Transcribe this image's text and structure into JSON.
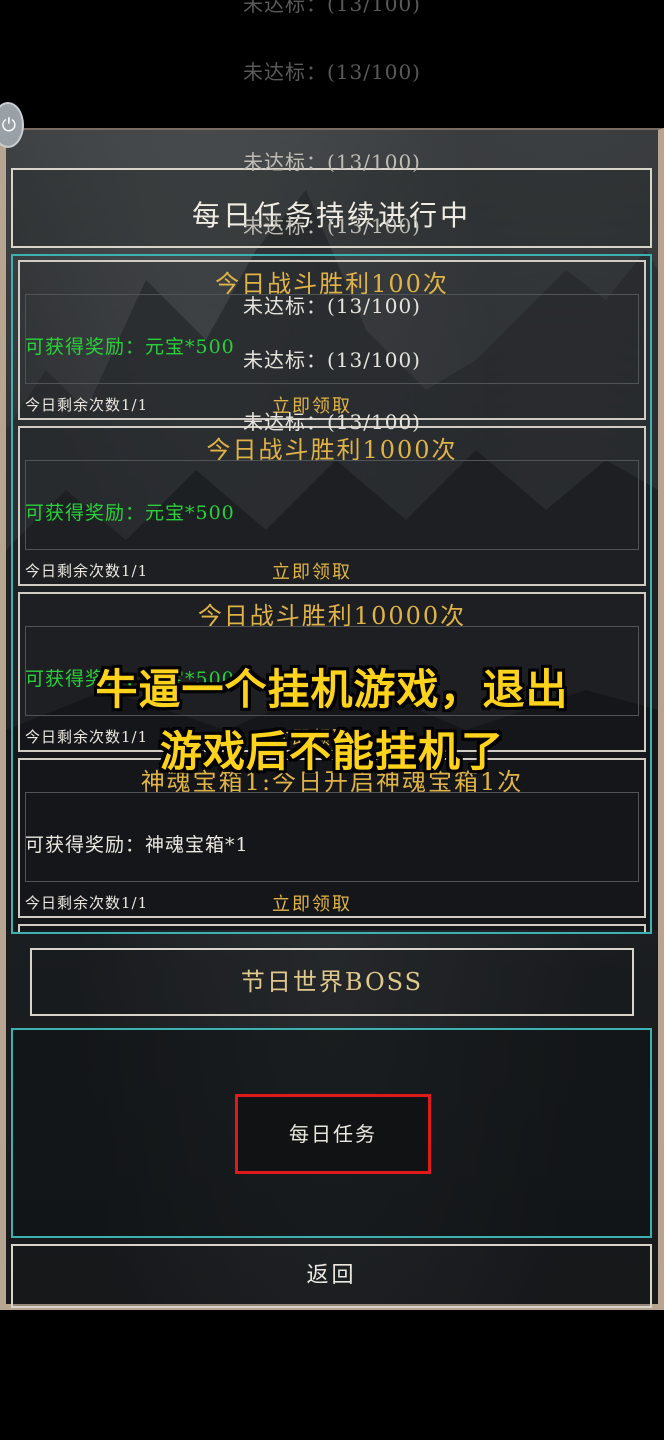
{
  "progress_overlay": {
    "line1": "未达标：(13/100)",
    "line2": "未达标：(13/100)",
    "line3": "未达标：(13/100)",
    "line4": "未达标：(13/100)",
    "line5": "未达标：(13/100)",
    "line6": "未达标：(13/100)",
    "line7": "未达标：(13/100)",
    "line8": "未达标：(13/100)"
  },
  "header": {
    "title": "每日任务持续进行中"
  },
  "tasks": [
    {
      "title": "今日战斗胜利100次",
      "reward": "可获得奖励：元宝*500",
      "remaining": "今日剩余次数1/1",
      "claim": "立即领取"
    },
    {
      "title": "今日战斗胜利1000次",
      "reward": "可获得奖励：元宝*500",
      "remaining": "今日剩余次数1/1",
      "claim": "立即领取"
    },
    {
      "title": "今日战斗胜利10000次",
      "reward": "可获得奖励：元宝*500",
      "remaining": "今日剩余次数1/1",
      "claim": "立即领取"
    },
    {
      "title": "神魂宝箱1:今日开启神魂宝箱1次",
      "reward": "可获得奖励：神魂宝箱*1",
      "remaining": "今日剩余次数1/1",
      "claim": "立即领取"
    }
  ],
  "boss_button": {
    "label": "节日世界BOSS"
  },
  "tab_area": {
    "daily_tab_label": "每日任务",
    "highlight_color": "#e01a1a"
  },
  "back_button": {
    "label": "返回"
  },
  "caption": {
    "line1": "牛逼一个挂机游戏，退出",
    "line2": "游戏后不能挂机了"
  },
  "colors": {
    "task_title": "#e0b347",
    "reward_text": "#28d13a",
    "panel_border_cyan": "#3fb0b2",
    "frame_border": "#b7a491",
    "caption": "#ffd21c"
  },
  "icons": {
    "power": "power-icon"
  }
}
